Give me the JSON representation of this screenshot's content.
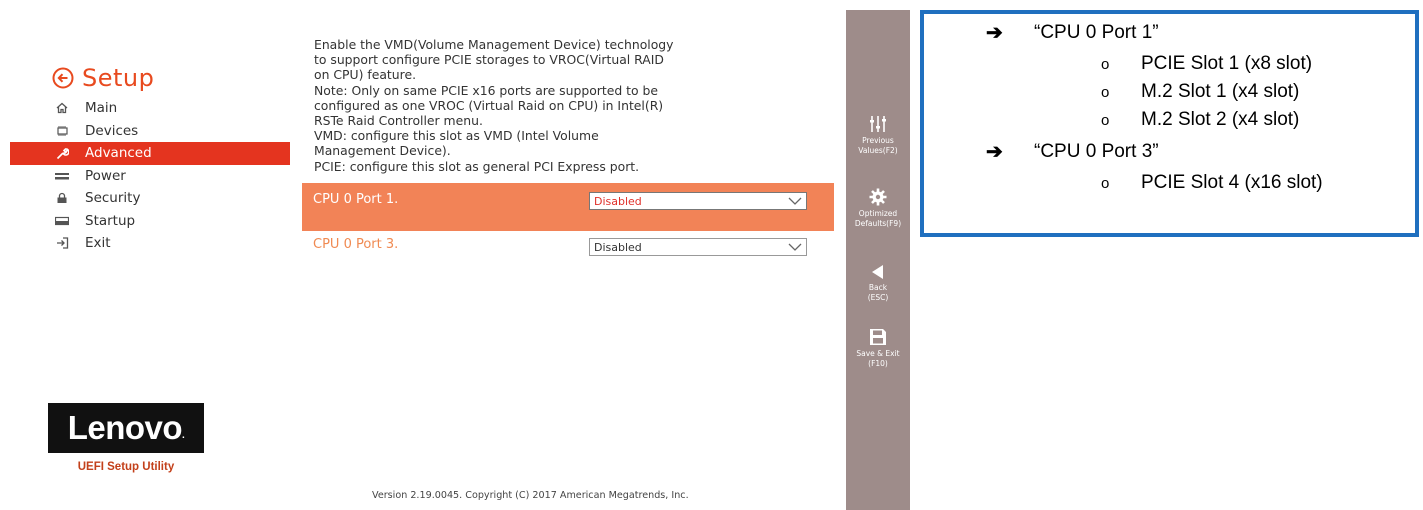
{
  "sidebar": {
    "title": "Setup",
    "items": [
      {
        "label": "Main",
        "icon": "home-icon"
      },
      {
        "label": "Devices",
        "icon": "devices-icon"
      },
      {
        "label": "Advanced",
        "icon": "wrench-icon",
        "active": true
      },
      {
        "label": "Power",
        "icon": "power-icon"
      },
      {
        "label": "Security",
        "icon": "lock-icon"
      },
      {
        "label": "Startup",
        "icon": "startup-icon"
      },
      {
        "label": "Exit",
        "icon": "exit-icon"
      }
    ],
    "logo": "Lenovo",
    "utility": "UEFI Setup Utility"
  },
  "help": {
    "lines": [
      "Enable the VMD(Volume Management Device) technology",
      "to support configure PCIE storages to VROC(Virtual RAID",
      "on CPU) feature.",
      "Note: Only on same PCIE x16 ports are supported to be",
      "configured as one VROC (Virtual Raid on CPU) in Intel(R)",
      "RSTe Raid Controller menu.",
      "VMD: configure this slot as VMD (Intel Volume",
      "Management Device).",
      "PCIE: configure this slot as general PCI Express port."
    ]
  },
  "settings": [
    {
      "label": "CPU 0 Port 1.",
      "value": "Disabled",
      "selected": true
    },
    {
      "label": "CPU 0 Port 3.",
      "value": "Disabled",
      "selected": false
    }
  ],
  "version": "Version 2.19.0045. Copyright (C) 2017 American Megatrends, Inc.",
  "actions": [
    {
      "line1": "Previous",
      "line2": "Values(F2)",
      "icon": "sliders-icon"
    },
    {
      "line1": "Optimized",
      "line2": "Defaults(F9)",
      "icon": "gear-icon"
    },
    {
      "line1": "Back",
      "line2": "(ESC)",
      "icon": "back-arrow-icon"
    },
    {
      "line1": "Save & Exit",
      "line2": "(F10)",
      "icon": "save-icon"
    }
  ],
  "annotation": {
    "groups": [
      {
        "port": "“CPU 0 Port 1”",
        "slots": [
          "PCIE Slot 1 (x8 slot)",
          "M.2 Slot 1 (x4 slot)",
          "M.2 Slot 2 (x4 slot)"
        ]
      },
      {
        "port": "“CPU 0 Port 3”",
        "slots": [
          "PCIE Slot 4 (x16 slot)"
        ]
      }
    ],
    "arrow": "➔",
    "bullet": "o"
  },
  "colors": {
    "accent": "#e4341f",
    "selected_row": "#f28357",
    "action_bar": "#9e8c8a",
    "annotation_border": "#1f6fbf"
  }
}
